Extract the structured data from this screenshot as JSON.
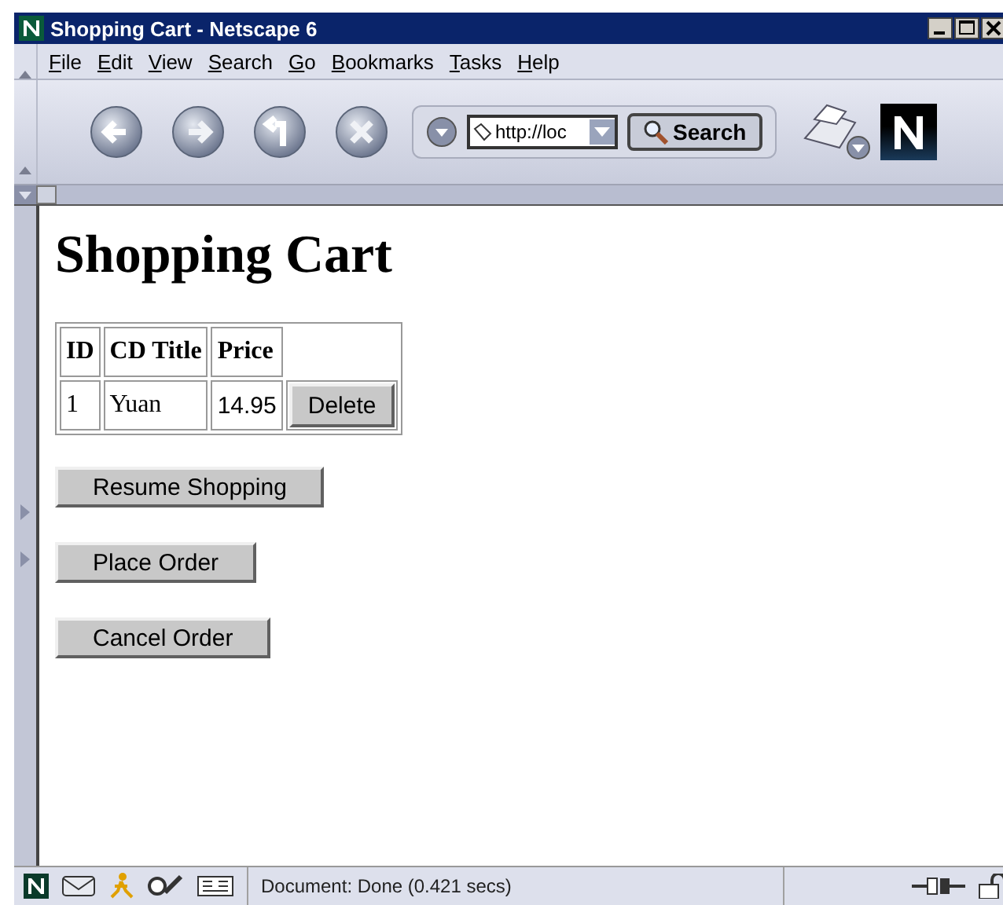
{
  "window": {
    "title": "Shopping Cart - Netscape 6"
  },
  "menu": [
    "File",
    "Edit",
    "View",
    "Search",
    "Go",
    "Bookmarks",
    "Tasks",
    "Help"
  ],
  "toolbar": {
    "url": "http://loc",
    "search_button": "Search"
  },
  "page": {
    "heading": "Shopping Cart",
    "table": {
      "columns": [
        "ID",
        "CD Title",
        "Price"
      ],
      "rows": [
        {
          "id": "1",
          "title": "Yuan",
          "price": "14.95",
          "action": "Delete"
        }
      ]
    },
    "buttons": [
      {
        "label": "Resume Shopping"
      },
      {
        "label": "Place Order"
      },
      {
        "label": "Cancel Order"
      }
    ]
  },
  "status_bar": {
    "text": "Document: Done (0.421 secs)"
  }
}
